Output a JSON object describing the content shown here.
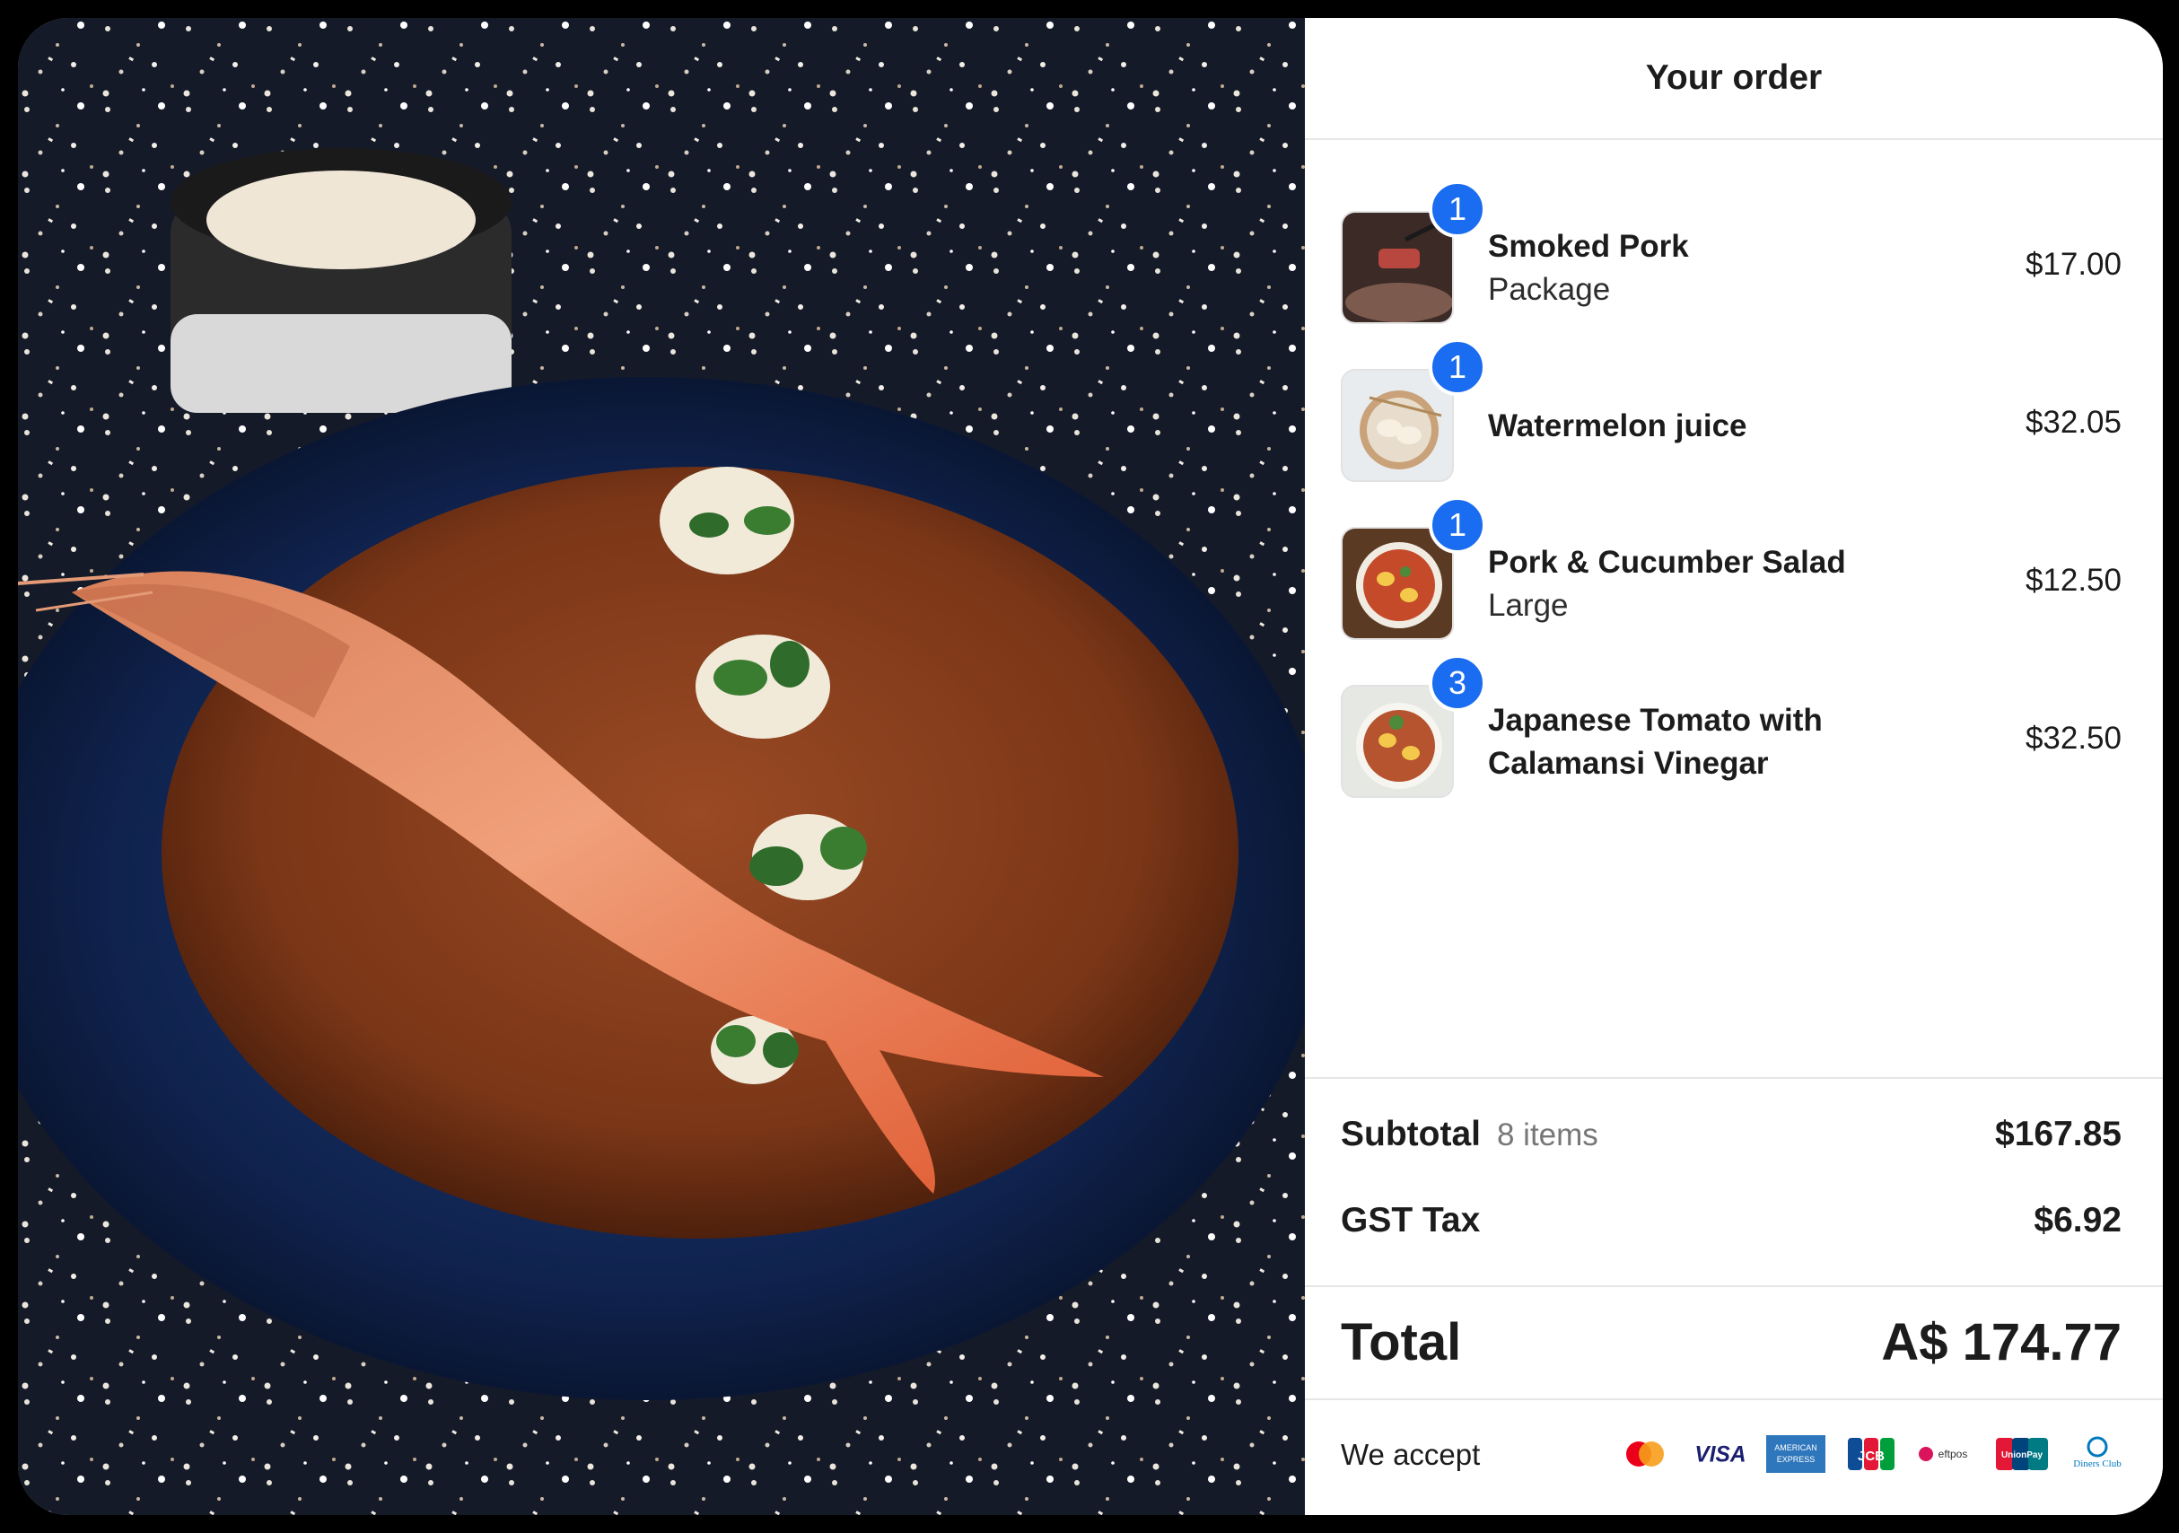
{
  "header": {
    "title": "Your order"
  },
  "order_items": [
    {
      "qty": "1",
      "name": "Smoked Pork",
      "option": "Package",
      "price": "$17.00",
      "thumb": "sliced-meat-thumbnail"
    },
    {
      "qty": "1",
      "name": "Watermelon juice",
      "option": "",
      "price": "$32.05",
      "thumb": "dumplings-thumbnail"
    },
    {
      "qty": "1",
      "name": "Pork & Cucumber Salad",
      "option": "Large",
      "price": "$12.50",
      "thumb": "ramen-bowl-thumbnail"
    },
    {
      "qty": "3",
      "name": "Japanese Tomato with Calamansi Vinegar",
      "option": "",
      "price": "$32.50",
      "thumb": "noodle-bowl-thumbnail"
    }
  ],
  "summary": {
    "subtotal_label": "Subtotal",
    "subtotal_count": "8 items",
    "subtotal_value": "$167.85",
    "tax_label": "GST Tax",
    "tax_value": "$6.92",
    "total_label": "Total",
    "total_value": "A$ 174.77"
  },
  "payment": {
    "label": "We accept",
    "methods": [
      {
        "name": "mastercard-icon",
        "text": ""
      },
      {
        "name": "visa-icon",
        "text": "VISA"
      },
      {
        "name": "amex-icon",
        "text": "AMERICAN EXPRESS"
      },
      {
        "name": "jcb-icon",
        "text": "JCB"
      },
      {
        "name": "eftpos-icon",
        "text": "eftpos"
      },
      {
        "name": "unionpay-icon",
        "text": "UnionPay"
      },
      {
        "name": "diners-club-icon",
        "text": "Diners Club"
      }
    ]
  },
  "colors": {
    "badge": "#1a6cf0",
    "text": "#1c1c1c",
    "divider": "#e6e6e6"
  }
}
